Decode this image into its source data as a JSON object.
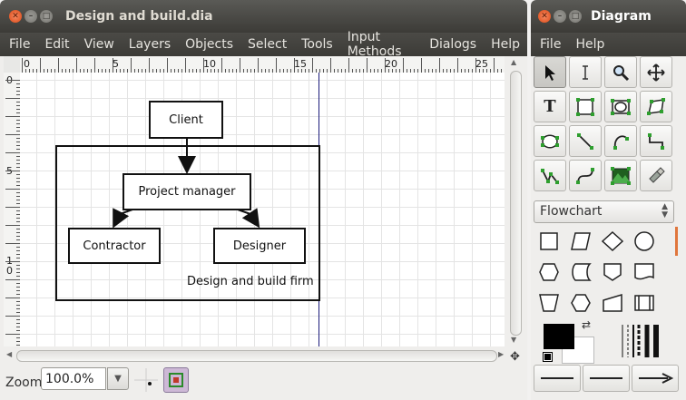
{
  "main_window": {
    "title": "Design and build.dia",
    "menu": [
      "File",
      "Edit",
      "View",
      "Layers",
      "Objects",
      "Select",
      "Tools",
      "Input Methods",
      "Dialogs",
      "Help"
    ]
  },
  "ruler": {
    "horizontal": [
      "0",
      "5",
      "10",
      "15",
      "20",
      "25"
    ],
    "vertical": [
      "0",
      "5",
      "1 0"
    ]
  },
  "diagram": {
    "nodes": {
      "client": "Client",
      "project_manager": "Project manager",
      "contractor": "Contractor",
      "designer": "Designer"
    },
    "group_label": "Design and build firm"
  },
  "statusbar": {
    "zoom_label": "Zoom",
    "zoom_value": "100.0%"
  },
  "toolbox_window": {
    "title": "Diagram",
    "menu": [
      "File",
      "Help"
    ],
    "tools": [
      "pointer-icon",
      "text-edit-icon",
      "magnify-icon",
      "scroll-icon",
      "text-icon",
      "box-icon",
      "ellipse-icon",
      "polygon-icon",
      "beziergon-icon",
      "line-icon",
      "arc-icon",
      "zigzag-line-icon",
      "polyline-icon",
      "bezier-line-icon",
      "image-icon",
      "outline-icon"
    ],
    "sheet": "Flowchart",
    "colors": {
      "foreground": "#000000",
      "background": "#ffffff",
      "accent": "#e0763c"
    }
  }
}
